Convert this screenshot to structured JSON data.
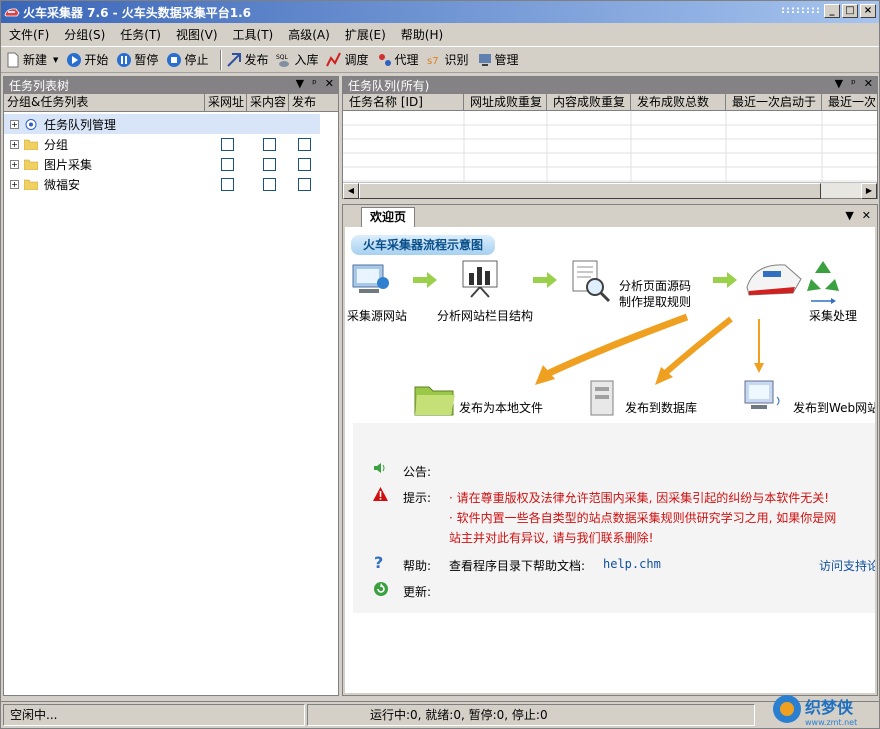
{
  "window": {
    "title": "火车采集器 7.6 - 火车头数据采集平台1.6",
    "dots": "::::::::",
    "btn_min": "_",
    "btn_max": "□",
    "btn_close": "×"
  },
  "menu": [
    "文件(F)",
    "分组(S)",
    "任务(T)",
    "视图(V)",
    "工具(T)",
    "高级(A)",
    "扩展(E)",
    "帮助(H)"
  ],
  "toolbar": {
    "new": "新建",
    "new_arrow": "▼",
    "start": "开始",
    "pause": "暂停",
    "stop": "停止",
    "publish": "发布",
    "import": "入库",
    "schedule": "调度",
    "proxy": "代理",
    "recognize": "识别",
    "manage": "管理"
  },
  "left_panel": {
    "title": "任务列表树",
    "pin": "▼ 📌 ×",
    "columns": [
      "分组&任务列表",
      "采网址",
      "采内容",
      "发布"
    ],
    "rows": [
      {
        "label": "任务队列管理",
        "has_checks": false
      },
      {
        "label": "分组",
        "has_checks": true
      },
      {
        "label": "图片采集",
        "has_checks": true
      },
      {
        "label": "微福安",
        "has_checks": true
      }
    ]
  },
  "queue_panel": {
    "title": "任务队列(所有)",
    "columns": [
      "任务名称 [ID]",
      "网址成败重复",
      "内容成败重复",
      "发布成败总数",
      "最近一次启动于",
      "最近一次"
    ]
  },
  "welcome": {
    "tab": "欢迎页",
    "flow_title": "火车采集器流程示意图",
    "steps": [
      "采集源网站",
      "分析网站栏目结构",
      "分析页面源码",
      "制作提取规则",
      "采集处理"
    ],
    "outputs": [
      "发布为本地文件",
      "发布到数据库",
      "发布到Web网站"
    ],
    "notice_label": "公告:",
    "tip_label": "提示:",
    "tip1": "· 请在尊重版权及法律允许范围内采集, 因采集引起的纠纷与本软件无关!",
    "tip2a": "· 软件内置一些各自类型的站点数据采集规则供研究学习之用, 如果你是网",
    "tip2b": "站主并对此有异议, 请与我们联系删除!",
    "help_label": "帮助:",
    "help_text": "查看程序目录下帮助文档:",
    "help_file": "help.chm",
    "support_link": "访问支持论",
    "update_label": "更新:"
  },
  "status": {
    "left": "空闲中...",
    "counts": "运行中:0, 就绪:0, 暂停:0, 停止:0",
    "logo_text": "织梦侠",
    "logo_url": "www.zmt.net"
  },
  "colors": {
    "titlebar": "#3a66b8",
    "panelhead": "#848284",
    "tip": "#d01010",
    "link": "#1050a0"
  }
}
